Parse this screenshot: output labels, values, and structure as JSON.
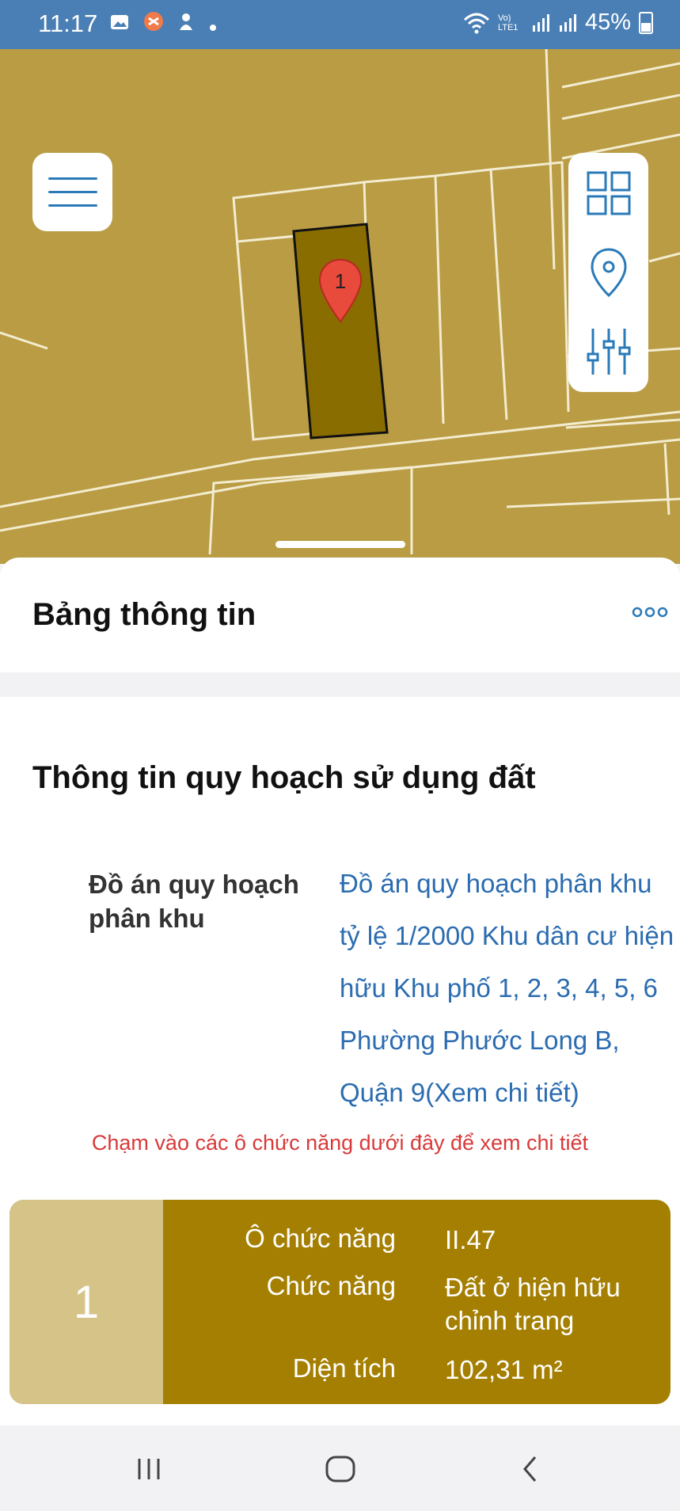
{
  "status_bar": {
    "time": "11:17",
    "notification_icons": [
      "image-icon",
      "app-icon",
      "app-icon",
      "dot-icon"
    ],
    "network_label": "Vo) LTE1",
    "battery": "45%"
  },
  "map": {
    "marker_label": "1",
    "background_color": "#b99c44",
    "selected_parcel_color": "#8a6d00"
  },
  "panel": {
    "title": "Bảng thông tin",
    "more_icon": "more-horizontal-icon"
  },
  "info": {
    "section_title": "Thông tin quy hoạch sử dụng đất",
    "plan_label": "Đồ án quy hoạch phân khu",
    "plan_value": "Đồ án quy hoạch phân khu tỷ lệ 1/2000 Khu dân cư hiện hữu Khu phố 1, 2, 3, 4, 5, 6 Phường Phước Long B, Quận 9(Xem chi tiết)",
    "hint": "Chạm vào các ô chức năng dưới đây để xem chi tiết"
  },
  "function_card": {
    "number": "1",
    "rows": [
      {
        "label": "Ô chức năng",
        "value": "II.47"
      },
      {
        "label": "Chức năng",
        "value": "Đất ở hiện hữu chỉnh trang"
      },
      {
        "label": "Diện tích",
        "value": "102,31 m²"
      }
    ]
  },
  "colors": {
    "status_bar": "#4a7fb5",
    "accent_link": "#2b6cb0",
    "hint_red": "#d83a3a",
    "card_gold": "#a57f02",
    "card_light": "#d6c388"
  }
}
